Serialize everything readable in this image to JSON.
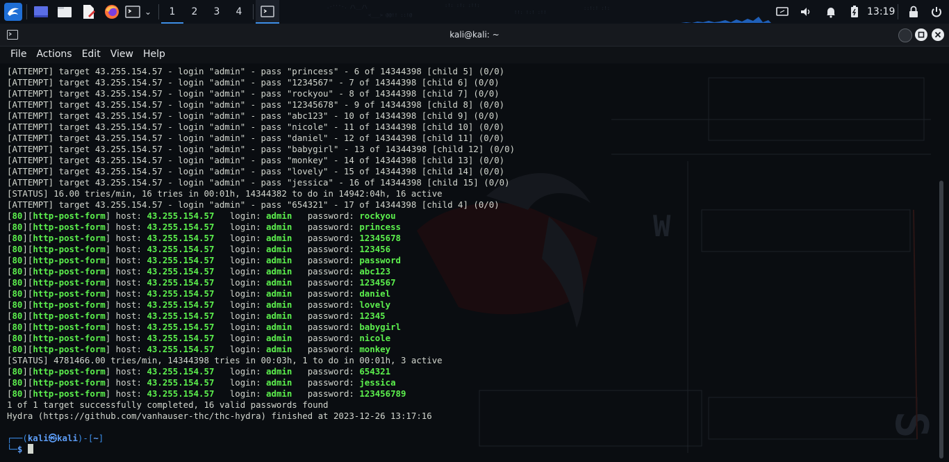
{
  "taskbar": {
    "workspaces": [
      "1",
      "2",
      "3",
      "4"
    ],
    "active_workspace": "1",
    "clock": "13:19",
    "icons": [
      "kali-menu-icon",
      "desktop-icon",
      "file-manager-icon",
      "text-editor-icon",
      "firefox-icon",
      "terminal-icon",
      "chevron-down-icon",
      "terminal-task-icon",
      "monitor-icon",
      "volume-icon",
      "bell-icon",
      "battery-icon",
      "lock-icon",
      "power-icon"
    ]
  },
  "window": {
    "title": "kali@kali: ~",
    "menu": [
      "File",
      "Actions",
      "Edit",
      "View",
      "Help"
    ]
  },
  "terminal": {
    "attempts": [
      "[ATTEMPT] target 43.255.154.57 - login \"admin\" - pass \"princess\" - 6 of 14344398 [child 5] (0/0)",
      "[ATTEMPT] target 43.255.154.57 - login \"admin\" - pass \"1234567\" - 7 of 14344398 [child 6] (0/0)",
      "[ATTEMPT] target 43.255.154.57 - login \"admin\" - pass \"rockyou\" - 8 of 14344398 [child 7] (0/0)",
      "[ATTEMPT] target 43.255.154.57 - login \"admin\" - pass \"12345678\" - 9 of 14344398 [child 8] (0/0)",
      "[ATTEMPT] target 43.255.154.57 - login \"admin\" - pass \"abc123\" - 10 of 14344398 [child 9] (0/0)",
      "[ATTEMPT] target 43.255.154.57 - login \"admin\" - pass \"nicole\" - 11 of 14344398 [child 10] (0/0)",
      "[ATTEMPT] target 43.255.154.57 - login \"admin\" - pass \"daniel\" - 12 of 14344398 [child 11] (0/0)",
      "[ATTEMPT] target 43.255.154.57 - login \"admin\" - pass \"babygirl\" - 13 of 14344398 [child 12] (0/0)",
      "[ATTEMPT] target 43.255.154.57 - login \"admin\" - pass \"monkey\" - 14 of 14344398 [child 13] (0/0)",
      "[ATTEMPT] target 43.255.154.57 - login \"admin\" - pass \"lovely\" - 15 of 14344398 [child 14] (0/0)",
      "[ATTEMPT] target 43.255.154.57 - login \"admin\" - pass \"jessica\" - 16 of 14344398 [child 15] (0/0)"
    ],
    "status1": "[STATUS] 16.00 tries/min, 16 tries in 00:01h, 14344382 to do in 14942:04h, 16 active",
    "attempt_last": "[ATTEMPT] target 43.255.154.57 - login \"admin\" - pass \"654321\" - 17 of 14344398 [child 4] (0/0)",
    "result_prefix": {
      "port": "80",
      "service": "http-post-form",
      "host_label": " host: ",
      "host": "43.255.154.57",
      "login_label": "   login: ",
      "login": "admin",
      "password_label": "   password: "
    },
    "found_passwords_1": [
      "rockyou",
      "princess",
      "12345678",
      "123456",
      "password",
      "abc123",
      "1234567",
      "daniel",
      "lovely",
      "12345",
      "babygirl",
      "nicole",
      "monkey"
    ],
    "status2": "[STATUS] 4781466.00 tries/min, 14344398 tries in 00:03h, 1 to do in 00:01h, 3 active",
    "found_passwords_2": [
      "654321",
      "jessica",
      "123456789"
    ],
    "summary": "1 of 1 target successfully completed, 16 valid passwords found",
    "finished": "Hydra (https://github.com/vanhauser-thc/thc-hydra) finished at 2023-12-26 13:17:16",
    "prompt_user": "kali",
    "prompt_at": "㉿",
    "prompt_host": "kali",
    "prompt_dir": "~",
    "prompt_symbol": "$"
  },
  "colors": {
    "green": "#5cf04d",
    "text": "#d3d7cf",
    "prompt_blue": "#3b8eea",
    "accent": "#3d8ee6"
  }
}
